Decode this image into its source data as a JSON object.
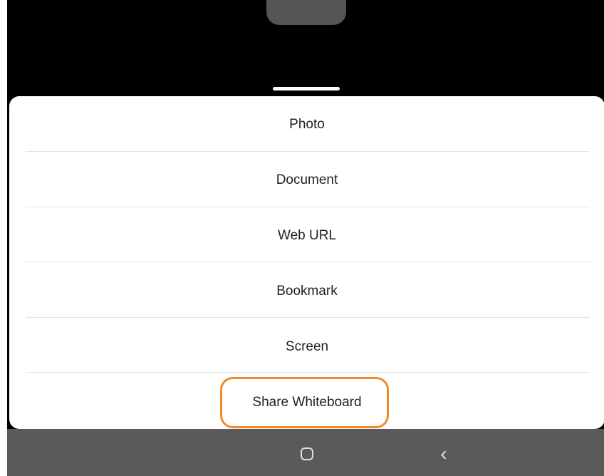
{
  "sheet": {
    "items": [
      {
        "label": "Photo"
      },
      {
        "label": "Document"
      },
      {
        "label": "Web URL"
      },
      {
        "label": "Bookmark"
      },
      {
        "label": "Screen"
      },
      {
        "label": "Share Whiteboard"
      }
    ]
  },
  "annotation": {
    "highlight_color": "#f08a2c",
    "highlighted_item": "Share Whiteboard"
  },
  "navbar": {
    "icons": [
      "home-icon",
      "back-icon"
    ]
  },
  "colors": {
    "background": "#000000",
    "sheet": "#ffffff",
    "navbar": "#5a5a5a"
  }
}
